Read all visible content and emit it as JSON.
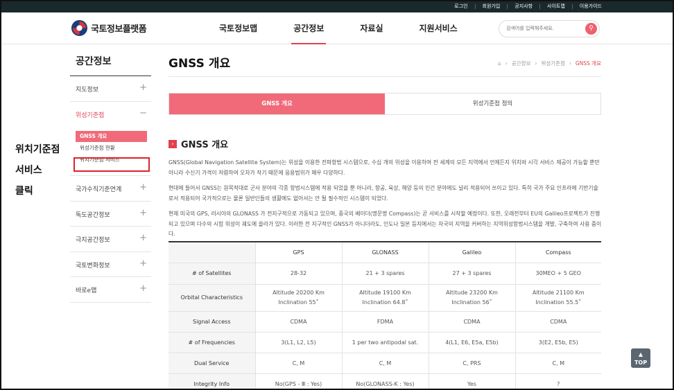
{
  "topbar": {
    "links": [
      "로그인",
      "회원가입",
      "공지사항",
      "사이트맵",
      "이용가이드"
    ]
  },
  "header": {
    "logo_text": "국토정보플랫폼",
    "nav": [
      "국토정보맵",
      "공간정보",
      "자료실",
      "지원서비스"
    ],
    "active_nav": "공간정보",
    "search_placeholder": "검색어를 입력해주세요.",
    "search_icon": "search-icon"
  },
  "sidebar": {
    "title": "공간정보",
    "items": [
      {
        "label": "지도정보",
        "toggle": "+"
      },
      {
        "label": "위성기준점",
        "toggle": "−"
      },
      {
        "label": "국가수직기준연계",
        "toggle": "+"
      },
      {
        "label": "독도공간정보",
        "toggle": "+"
      },
      {
        "label": "극지공간정보",
        "toggle": "+"
      },
      {
        "label": "국토변화정보",
        "toggle": "+"
      },
      {
        "label": "바로e맵",
        "toggle": "+"
      }
    ],
    "sub_items": [
      "GNSS 개요",
      "위성기준점 현황",
      "위치기준점 서비스"
    ]
  },
  "annotation": {
    "line1": "위치기준점",
    "line2": "서비스",
    "line3": "클릭",
    "highlight_color": "#e0202a"
  },
  "content": {
    "page_title": "GNSS 개요",
    "breadcrumb": [
      "공간정보",
      "위성기준점",
      "GNSS 개요"
    ],
    "tabs": [
      "GNSS 개요",
      "위성기준점 정의"
    ],
    "section_title": "GNSS 개요",
    "paragraphs": [
      "GNSS(Global Navigation Satellite System)는 위성을 이용한 전파항법 시스템으로, 수십 개의 위성을 이용하여 전 세계의 모든 지역에서 언제든지 위치와 시각 서비스 제공이 가능할 뿐만 아니라 수신기 가격이 저렴하여 오차가 작기 때문에 응용범위가 매우 다양하다.",
      "현대에 들어서 GNSS는 원목적대로 군사 분야의 각종 항법시스템에 적용 되었을 뿐 아니라, 항공, 육상, 해양 등의 민간 분야에도 널리 적용되어 쓰이고 있다. 특히 국가 주요 인프라에 기반기술로서 적용되어 국가적으로는 물론 일반인들의 생활에도 없어서는 안 될 필수적인 시스템이 되었다.",
      "현재 미국의 GPS, 러시아의 GLONASS 가 전지구적으로 가동되고 있으며, 중국의 베이더(명문명 Compass)는 곧 서비스를 시작할 예정이다. 또한, 오래전부터 EU의 Galileo프로젝트가 진행되고 있으며 다수의 시험 위성이 궤도에 올라가 있다. 이러한 전 지구적인 GNSS가 아니더라도, 인도나 일본 등지에서는 자국의 지역을 커버하는 지역위성항법시스템을 개발, 구축하여 사용 중이다."
    ],
    "table": {
      "headers": [
        "",
        "GPS",
        "GLONASS",
        "Galileo",
        "Compass"
      ],
      "rows": [
        {
          "label": "# of Satellites",
          "cells": [
            "28-32",
            "21 + 3 spares",
            "27 + 3 spares",
            "30MEO + 5 GEO"
          ]
        },
        {
          "label": "Orbital Characteristics",
          "cells": [
            "Altitude 20200 Km\nInclination 55˚",
            "Altitude 19100 Km\nInclination 64.8˚",
            "Altitude 23200 Km\nInclination 56˚",
            "Altitude 21100 Km\nInclination 55.5˚"
          ]
        },
        {
          "label": "Signal Access",
          "cells": [
            "CDMA",
            "FDMA",
            "CDMA",
            "CDMA"
          ]
        },
        {
          "label": "# of Frequencies",
          "cells": [
            "3(L1, L2, L5)",
            "1 per two antipodal sat.",
            "4(L1, E6, E5a, E5b)",
            "3(E2, E5b, E5)"
          ]
        },
        {
          "label": "Dual Service",
          "cells": [
            "C, M",
            "C, M",
            "C, PRS",
            "C, M"
          ]
        },
        {
          "label": "Integrity Info",
          "cells": [
            "No(GPS - Ⅲ : Yes)",
            "No(GLONASS-K : Yes)",
            "Yes",
            "?"
          ]
        }
      ]
    },
    "top_button": "TOP",
    "accent_color": "#f06a79"
  }
}
